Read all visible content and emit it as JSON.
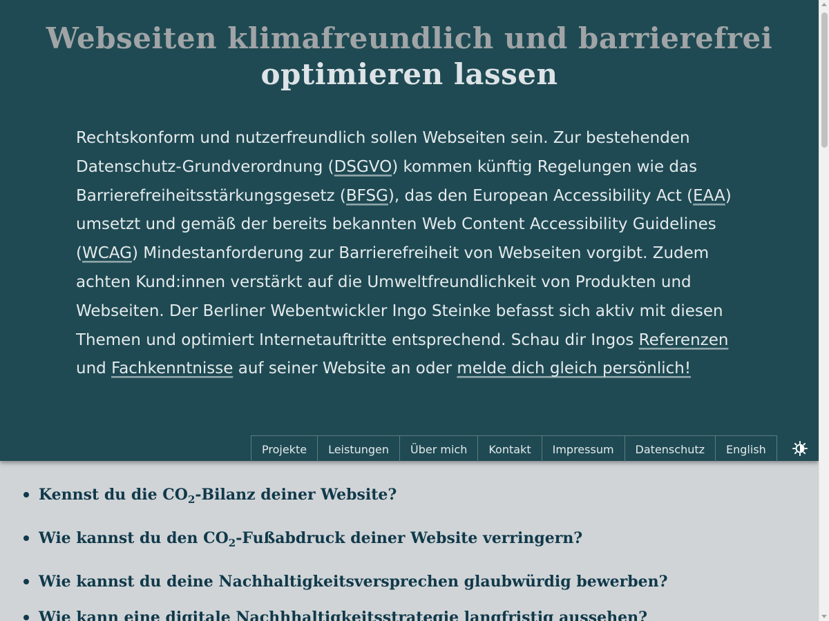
{
  "header": {
    "title_line1": "Webseiten klimafreundlich und barrierefrei",
    "title_line2": "optimieren lassen"
  },
  "intro": {
    "t1": "Rechtskonform und nutzerfreundlich sollen Webseiten sein. Zur bestehenden Datenschutz-Grundverordnung (",
    "link_dsgvo": "DSGVO",
    "t2": ") kommen künftig Regelungen wie das Barrierefreiheitsstärkungsgesetz (",
    "link_bfsg": "BFSG",
    "t3": "), das den European Accessibility Act (",
    "link_eaa": "EAA",
    "t4": ") umsetzt und gemäß der bereits bekannten Web Content Accessibility Guidelines (",
    "link_wcag": "WCAG",
    "t5": ") Mindestanforderung zur Barrierefreiheit von Webseiten vorgibt. Zudem achten Kund:innen verstärkt auf die Umweltfreundlichkeit von Produkten und Webseiten. Der Berliner Webentwickler Ingo Steinke befasst sich aktiv mit diesen Themen und optimiert Internetauftritte entsprechend. Schau dir Ingos ",
    "link_referenzen": "Referenzen",
    "t6": " und ",
    "link_fachkenntnisse": "Fachkenntnisse",
    "t7": " auf seiner Website an oder ",
    "link_kontakt": "melde dich gleich persönlich!"
  },
  "nav": {
    "items": [
      {
        "label": "Projekte"
      },
      {
        "label": "Leistungen"
      },
      {
        "label": "Über mich"
      },
      {
        "label": "Kontakt"
      },
      {
        "label": "Impressum"
      },
      {
        "label": "Datenschutz"
      },
      {
        "label": "English"
      }
    ],
    "theme_toggle_icon": "contrast-icon"
  },
  "faq": {
    "q1_pre": "Kennst du die CO",
    "q1_sub": "2",
    "q1_post": "-Bilanz deiner Website?",
    "q2_pre": "Wie kannst du den CO",
    "q2_sub": "2",
    "q2_post": "-Fußabdruck deiner Website verringern?",
    "q3": "Wie kannst du deine Nachhaltigkeitsversprechen glaubwürdig bewerben?",
    "q4": "Wie kann eine digitale Nachhhaltigkeitsstrategie langfristig aussehen?"
  },
  "colors": {
    "header_bg": "#1f4a53",
    "page_bg": "#d0d4d7",
    "heading_text": "#10394a"
  }
}
